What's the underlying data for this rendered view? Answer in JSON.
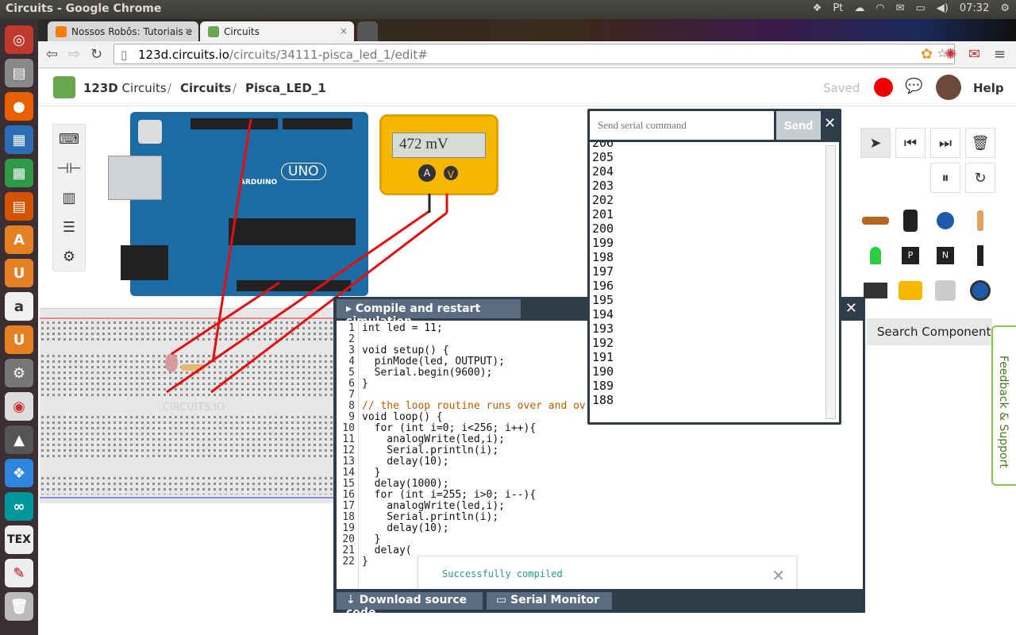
{
  "window_title": "Circuits - Google Chrome",
  "clock": "07:32",
  "tabs": [
    {
      "label": "Nossos Robôs: Tutoriais e"
    },
    {
      "label": "Circuits"
    }
  ],
  "address": {
    "host": "123d.circuits.io",
    "path": "/circuits/34111-pisca_led_1/edit#"
  },
  "app": {
    "brand": "123D",
    "brand_suffix": "Circuits",
    "crumb_circuits": "Circuits",
    "crumb_project": "Pisca_LED_1",
    "separator": "/",
    "status": "Saved",
    "help": "Help"
  },
  "multimeter": {
    "reading": "472 mV",
    "mode_a": "A",
    "mode_v": "V"
  },
  "board": {
    "name": "UNO",
    "brand": "ARDUINO",
    "watermark": "CIRCUITS.IO"
  },
  "serial_monitor": {
    "placeholder": "Send serial command",
    "send_label": "Send",
    "lines": [
      "206",
      "205",
      "204",
      "203",
      "202",
      "201",
      "200",
      "199",
      "198",
      "197",
      "196",
      "195",
      "194",
      "193",
      "192",
      "191",
      "190",
      "189",
      "188"
    ]
  },
  "code_panel": {
    "compile_label": "Compile and restart simulation",
    "download_label": "Download source code",
    "serial_label": "Serial Monitor",
    "toast": "Successfully compiled",
    "lines": [
      "int led = 11;",
      "",
      "void setup() {",
      "  pinMode(led, OUTPUT);",
      "  Serial.begin(9600);",
      "}",
      "",
      "// the loop routine runs over and ov",
      "void loop() {",
      "  for (int i=0; i<256; i++){",
      "    analogWrite(led,i);",
      "    Serial.println(i);",
      "    delay(10);",
      "  }",
      "  delay(1000);",
      "  for (int i=255; i>0; i--){",
      "    analogWrite(led,i);",
      "    Serial.println(i);",
      "    delay(10);",
      "  }",
      "  delay(",
      "}"
    ]
  },
  "search_component": "Search Component",
  "feedback": "Feedback & Support",
  "colors": {
    "wire": "#e01010",
    "panel": "#2f3d4a",
    "multimeter": "#f5b700",
    "board": "#1d6ba3"
  }
}
